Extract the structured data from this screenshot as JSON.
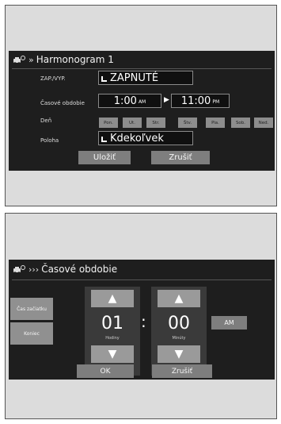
{
  "panel1": {
    "title": "Harmonogram 1",
    "onoff": {
      "label": "ZAP./VYP.",
      "value": "ZAPNUTÉ"
    },
    "period": {
      "label": "Časové obdobie",
      "start_time": "1:00",
      "start_suffix": "AM",
      "end_time": "11:00",
      "end_suffix": "PM"
    },
    "days": {
      "label": "Deň",
      "items": [
        "Pon.",
        "Ut.",
        "Str.",
        "Štv.",
        "Pia.",
        "Sob.",
        "Ned."
      ]
    },
    "location": {
      "label": "Poloha",
      "value": "Kdekoľvek"
    },
    "save_label": "Uložiť",
    "cancel_label": "Zrušiť"
  },
  "panel2": {
    "title": "Časové obdobie",
    "start_button": "Čas začiatku",
    "end_button": "Koniec",
    "hours": {
      "value": "01",
      "unit": "Hodiny"
    },
    "separator": ":",
    "minutes": {
      "value": "00",
      "unit": "Minúty"
    },
    "ampm": "AM",
    "ok_label": "OK",
    "cancel_label": "Zrušiť"
  },
  "icons": {
    "car": "car-clock-icon",
    "chevrons": "double-chevron-icon",
    "up": "up-arrow-icon",
    "down": "down-arrow-icon"
  },
  "colors": {
    "screen_bg": "#1e1e1e",
    "panel_bg": "#dcdcdc",
    "button_bg": "#7e7e7e",
    "day_bg": "#8d8d8d"
  }
}
